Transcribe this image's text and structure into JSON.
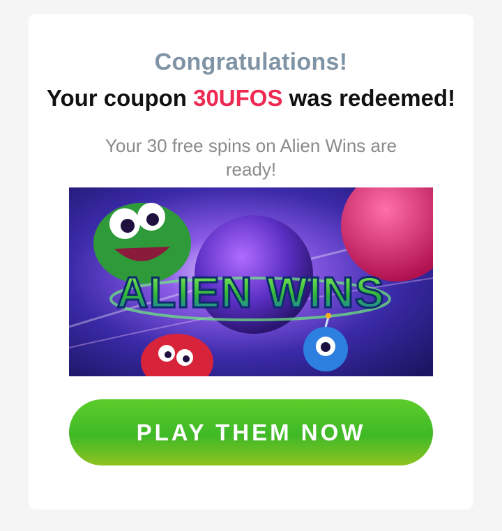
{
  "heading": {
    "congrats": "Congratulations!",
    "coupon_prefix": "Your coupon ",
    "coupon_code": "30UFOS",
    "coupon_suffix": " was redeemed!"
  },
  "message": "Your 30 free spins on Alien Wins are ready!",
  "game_banner": {
    "logo_text": "ALIEN WINS"
  },
  "cta": {
    "label": "PLAY THEM NOW"
  },
  "colors": {
    "coupon_accent": "#ee2a52",
    "button_green": "#4cc22a",
    "congrats_gray": "#7f93a4"
  }
}
